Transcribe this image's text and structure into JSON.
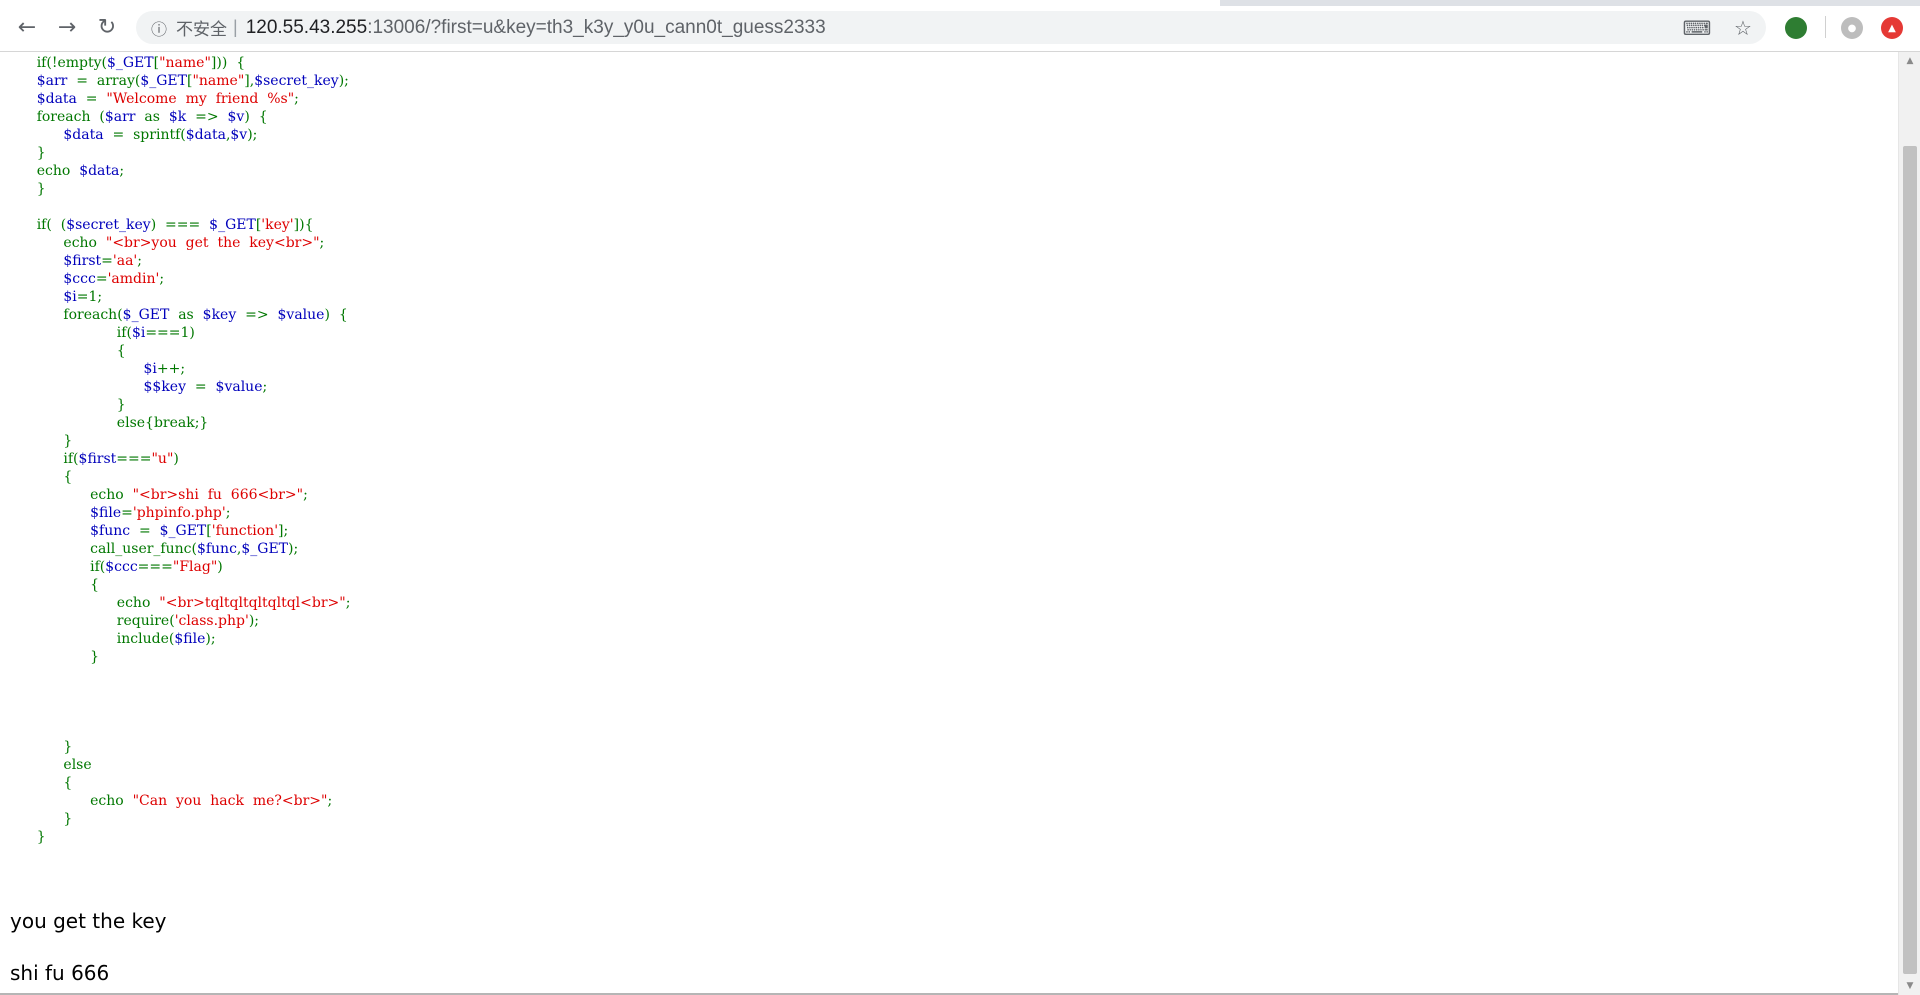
{
  "browser": {
    "security_label": "不安全",
    "separator": "|",
    "url_host": "120.55.43.255",
    "url_rest": ":13006/?first=u&key=th3_k3y_y0u_cann0t_guess2333",
    "nav_back_glyph": "←",
    "nav_forward_glyph": "→",
    "nav_reload_glyph": "↻",
    "info_glyph": "ⓘ",
    "translate_glyph": "⌨",
    "bookmark_glyph": "☆",
    "ext1_color": "#2e7d32",
    "ext3_color": "#e53935",
    "profile_glyph": "●",
    "ext3_glyph": "▲"
  },
  "code_lines": [
    [
      [
        "kw",
        "      if(!empty("
      ],
      [
        "var",
        "$_GET"
      ],
      [
        "kw",
        "["
      ],
      [
        "str",
        "\"name\""
      ],
      [
        "kw",
        "]))  {"
      ]
    ],
    [
      [
        "var",
        "      $arr"
      ],
      [
        "kw",
        "  =  array("
      ],
      [
        "var",
        "$_GET"
      ],
      [
        "kw",
        "["
      ],
      [
        "str",
        "\"name\""
      ],
      [
        "kw",
        "],"
      ],
      [
        "var",
        "$secret_key"
      ],
      [
        "kw",
        ");"
      ]
    ],
    [
      [
        "var",
        "      $data"
      ],
      [
        "kw",
        "  =  "
      ],
      [
        "str",
        "\"Welcome  my  friend  %s\""
      ],
      [
        "kw",
        ";"
      ]
    ],
    [
      [
        "kw",
        "      foreach  ("
      ],
      [
        "var",
        "$arr"
      ],
      [
        "kw",
        "  as  "
      ],
      [
        "var",
        "$k"
      ],
      [
        "kw",
        "  =>  "
      ],
      [
        "var",
        "$v"
      ],
      [
        "kw",
        ")  {"
      ]
    ],
    [
      [
        "var",
        "            $data"
      ],
      [
        "kw",
        "  =  sprintf("
      ],
      [
        "var",
        "$data"
      ],
      [
        "kw",
        ","
      ],
      [
        "var",
        "$v"
      ],
      [
        "kw",
        ");"
      ]
    ],
    [
      [
        "kw",
        "      }"
      ]
    ],
    [
      [
        "kw",
        "      echo  "
      ],
      [
        "var",
        "$data"
      ],
      [
        "kw",
        ";"
      ]
    ],
    [
      [
        "kw",
        "      }"
      ]
    ],
    [
      [
        "kw",
        ""
      ]
    ],
    [
      [
        "kw",
        "      if(  ("
      ],
      [
        "var",
        "$secret_key"
      ],
      [
        "kw",
        ")  ===  "
      ],
      [
        "var",
        "$_GET"
      ],
      [
        "kw",
        "["
      ],
      [
        "str",
        "'key'"
      ],
      [
        "kw",
        "]){"
      ]
    ],
    [
      [
        "kw",
        "            echo  "
      ],
      [
        "str",
        "\"<br>you  get  the  key<br>\""
      ],
      [
        "kw",
        ";"
      ]
    ],
    [
      [
        "var",
        "            $first"
      ],
      [
        "kw",
        "="
      ],
      [
        "str",
        "'aa'"
      ],
      [
        "kw",
        ";"
      ]
    ],
    [
      [
        "var",
        "            $ccc"
      ],
      [
        "kw",
        "="
      ],
      [
        "str",
        "'amdin'"
      ],
      [
        "kw",
        ";"
      ]
    ],
    [
      [
        "var",
        "            $i"
      ],
      [
        "kw",
        "=1;"
      ]
    ],
    [
      [
        "kw",
        "            foreach("
      ],
      [
        "var",
        "$_GET"
      ],
      [
        "kw",
        "  as  "
      ],
      [
        "var",
        "$key"
      ],
      [
        "kw",
        "  =>  "
      ],
      [
        "var",
        "$value"
      ],
      [
        "kw",
        ")  {"
      ]
    ],
    [
      [
        "kw",
        "                        if("
      ],
      [
        "var",
        "$i"
      ],
      [
        "kw",
        "===1)"
      ]
    ],
    [
      [
        "kw",
        "                        {"
      ]
    ],
    [
      [
        "var",
        "                              $i"
      ],
      [
        "kw",
        "++;"
      ]
    ],
    [
      [
        "var",
        "                              $$key"
      ],
      [
        "kw",
        "  =  "
      ],
      [
        "var",
        "$value"
      ],
      [
        "kw",
        ";"
      ]
    ],
    [
      [
        "kw",
        "                        }"
      ]
    ],
    [
      [
        "kw",
        "                        else{break;}"
      ]
    ],
    [
      [
        "kw",
        "            }"
      ]
    ],
    [
      [
        "kw",
        "            if("
      ],
      [
        "var",
        "$first"
      ],
      [
        "kw",
        "==="
      ],
      [
        "str",
        "\"u\""
      ],
      [
        "kw",
        ")"
      ]
    ],
    [
      [
        "kw",
        "            {"
      ]
    ],
    [
      [
        "kw",
        "                  echo  "
      ],
      [
        "str",
        "\"<br>shi  fu  666<br>\""
      ],
      [
        "kw",
        ";"
      ]
    ],
    [
      [
        "var",
        "                  $file"
      ],
      [
        "kw",
        "="
      ],
      [
        "str",
        "'phpinfo.php'"
      ],
      [
        "kw",
        ";"
      ]
    ],
    [
      [
        "var",
        "                  $func"
      ],
      [
        "kw",
        "  =  "
      ],
      [
        "var",
        "$_GET"
      ],
      [
        "kw",
        "["
      ],
      [
        "str",
        "'function'"
      ],
      [
        "kw",
        "];"
      ]
    ],
    [
      [
        "kw",
        "                  call_user_func("
      ],
      [
        "var",
        "$func"
      ],
      [
        "kw",
        ","
      ],
      [
        "var",
        "$_GET"
      ],
      [
        "kw",
        ");"
      ]
    ],
    [
      [
        "kw",
        "                  if("
      ],
      [
        "var",
        "$ccc"
      ],
      [
        "kw",
        "==="
      ],
      [
        "str",
        "\"Flag\""
      ],
      [
        "kw",
        ")"
      ]
    ],
    [
      [
        "kw",
        "                  {"
      ]
    ],
    [
      [
        "kw",
        "                        echo  "
      ],
      [
        "str",
        "\"<br>tqltqltqltqltql<br>\""
      ],
      [
        "kw",
        ";"
      ]
    ],
    [
      [
        "kw",
        "                        require("
      ],
      [
        "str",
        "'class.php'"
      ],
      [
        "kw",
        ");"
      ]
    ],
    [
      [
        "kw",
        "                        include("
      ],
      [
        "var",
        "$file"
      ],
      [
        "kw",
        ");"
      ]
    ],
    [
      [
        "kw",
        "                  }"
      ]
    ],
    [
      [
        "kw",
        ""
      ]
    ],
    [
      [
        "kw",
        ""
      ]
    ],
    [
      [
        "kw",
        ""
      ]
    ],
    [
      [
        "kw",
        ""
      ]
    ],
    [
      [
        "kw",
        "            }"
      ]
    ],
    [
      [
        "kw",
        "            else"
      ]
    ],
    [
      [
        "kw",
        "            {"
      ]
    ],
    [
      [
        "kw",
        "                  echo  "
      ],
      [
        "str",
        "\"Can  you  hack  me?<br>\""
      ],
      [
        "kw",
        ";"
      ]
    ],
    [
      [
        "kw",
        "            }"
      ]
    ],
    [
      [
        "kw",
        "      }"
      ]
    ]
  ],
  "output": {
    "line1": "you get the key",
    "line2": "shi fu 666"
  }
}
